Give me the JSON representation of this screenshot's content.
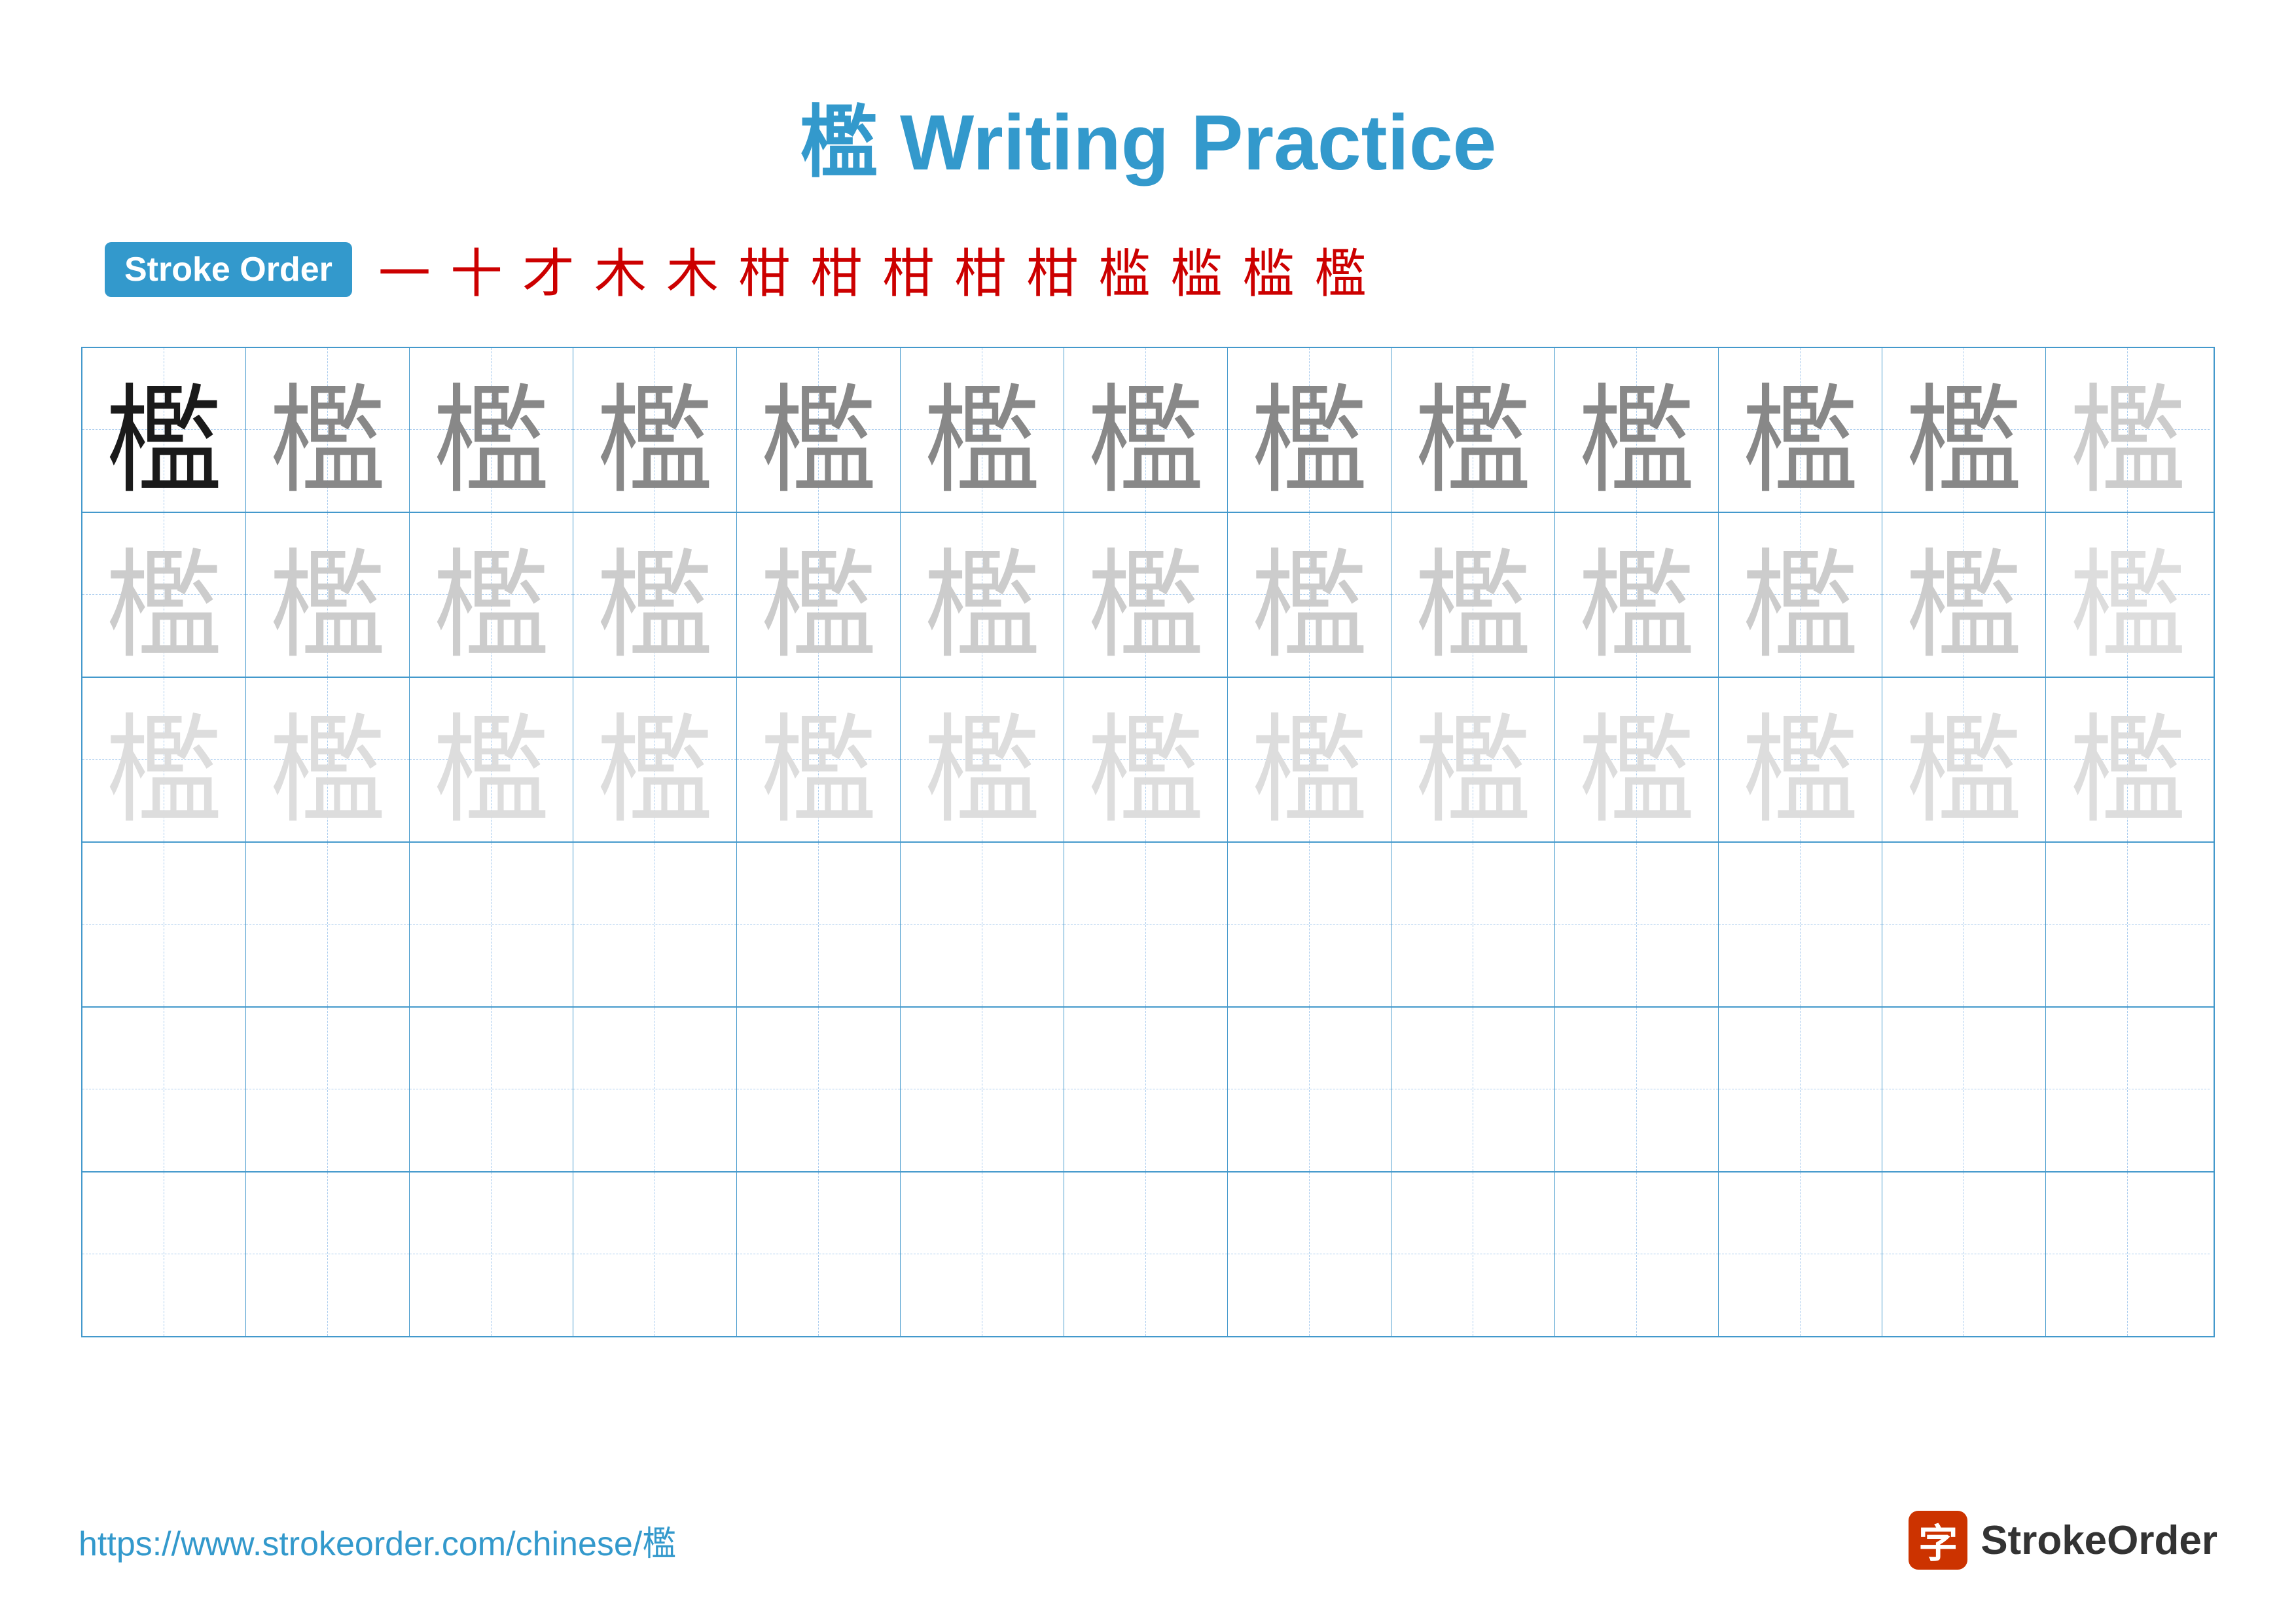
{
  "title": "檻 Writing Practice",
  "stroke_order_badge": "Stroke Order",
  "stroke_steps": [
    "一",
    "十",
    "才",
    "木",
    "木",
    "柑",
    "柑",
    "柑",
    "柑",
    "柑",
    "槛",
    "槛",
    "槛",
    "檻"
  ],
  "character": "檻",
  "rows": [
    {
      "cells": [
        "dark",
        "medium",
        "medium",
        "medium",
        "medium",
        "medium",
        "medium",
        "medium",
        "medium",
        "medium",
        "medium",
        "medium",
        "light"
      ]
    },
    {
      "cells": [
        "light",
        "light",
        "light",
        "light",
        "light",
        "light",
        "light",
        "light",
        "light",
        "light",
        "light",
        "light",
        "lighter"
      ]
    },
    {
      "cells": [
        "lighter",
        "lighter",
        "lighter",
        "lighter",
        "lighter",
        "lighter",
        "lighter",
        "lighter",
        "lighter",
        "lighter",
        "lighter",
        "lighter",
        "lighter"
      ]
    },
    {
      "cells": [
        "empty",
        "empty",
        "empty",
        "empty",
        "empty",
        "empty",
        "empty",
        "empty",
        "empty",
        "empty",
        "empty",
        "empty",
        "empty"
      ]
    },
    {
      "cells": [
        "empty",
        "empty",
        "empty",
        "empty",
        "empty",
        "empty",
        "empty",
        "empty",
        "empty",
        "empty",
        "empty",
        "empty",
        "empty"
      ]
    },
    {
      "cells": [
        "empty",
        "empty",
        "empty",
        "empty",
        "empty",
        "empty",
        "empty",
        "empty",
        "empty",
        "empty",
        "empty",
        "empty",
        "empty"
      ]
    }
  ],
  "footer": {
    "url": "https://www.strokeorder.com/chinese/檻",
    "logo_char": "字",
    "logo_text": "StrokeOrder"
  }
}
